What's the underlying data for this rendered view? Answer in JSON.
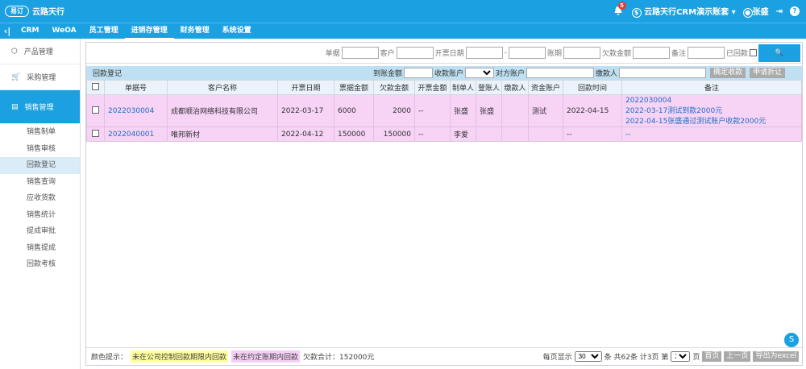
{
  "brand": {
    "mark": "易订",
    "name": "云路天行"
  },
  "topbar": {
    "notif_count": "5",
    "account": "云路天行CRM演示账套",
    "user": "张盛"
  },
  "nav": {
    "items": [
      "CRM",
      "WeOA",
      "员工管理",
      "进销存管理",
      "财务管理",
      "系统设置"
    ]
  },
  "sidebar": {
    "groups": [
      "产品管理",
      "采购管理",
      "销售管理"
    ],
    "items": [
      "销售制单",
      "销售审核",
      "回款登记",
      "销售查询",
      "应收货款",
      "销售统计",
      "提成审批",
      "销售提成",
      "回款考核"
    ]
  },
  "search": {
    "labels": [
      "单据",
      "客户",
      "开票日期",
      "-",
      "账期",
      "欠款金额",
      "备注",
      "已回款"
    ],
    "button": "🔍"
  },
  "toolbar": {
    "title": "回款登记",
    "labels": [
      "到账金额",
      "收款账户",
      "对方账户",
      "缴款人"
    ],
    "btn_confirm": "确定收款",
    "btn_discount": "申请折让"
  },
  "table": {
    "headers": [
      "单据号",
      "客户名称",
      "开票日期",
      "票据金额",
      "欠款金额",
      "开票金额",
      "制单人",
      "登账人",
      "缴款人",
      "资金账户",
      "回款时间",
      "备注"
    ],
    "rows": [
      {
        "doc": "2022030004",
        "customer": "成都顺治网络科技有限公司",
        "date": "2022-03-17",
        "bill": "6000",
        "owed": "2000",
        "invoiced": "--",
        "maker": "张盛",
        "poster": "张盛",
        "payer": "",
        "account": "测试",
        "paytime": "2022-04-15",
        "notes": [
          "2022030004",
          "2022-03-17测试到款2000元",
          "2022-04-15张盛通过测试账户收款2000元"
        ]
      },
      {
        "doc": "2022040001",
        "customer": "唯邦新材",
        "date": "2022-04-12",
        "bill": "150000",
        "owed": "150000",
        "invoiced": "--",
        "maker": "李爱",
        "poster": "",
        "payer": "",
        "account": "",
        "paytime": "--",
        "notes": [
          "--"
        ]
      }
    ]
  },
  "footer": {
    "hint": "颜色提示：",
    "legend1": "未在公司控制回款期限内回款",
    "legend2": "未在约定账期内回款",
    "total": "欠款合计：152000元",
    "per_page_label": "每页显示",
    "per_page": "30",
    "info": "条 共62条 计3页 第",
    "page": "3",
    "page_suffix": "页",
    "first": "首页",
    "prev": "上一页",
    "export": "导出为excel"
  }
}
